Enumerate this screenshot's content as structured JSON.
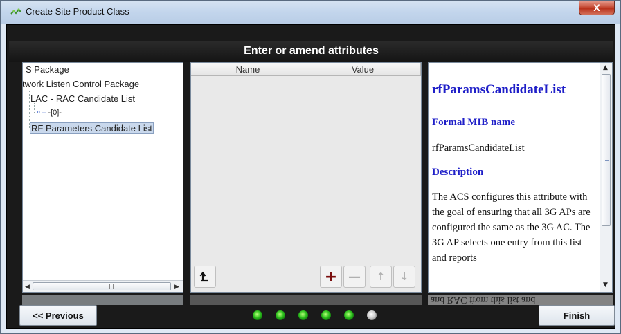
{
  "window": {
    "title": "Create Site Product Class",
    "close_label": "X"
  },
  "header": {
    "title": "Enter or amend attributes"
  },
  "tree": {
    "items": [
      {
        "label": "S Package"
      },
      {
        "label": "twork Listen Control Package"
      },
      {
        "label": "LAC - RAC Candidate List"
      },
      {
        "label": "-[0]-"
      },
      {
        "label": "RF Parameters Candidate List",
        "selected": true
      }
    ]
  },
  "table": {
    "columns": [
      "Name",
      "Value"
    ],
    "rows": []
  },
  "description": {
    "title": "rfParamsCandidateList",
    "formal_heading": "Formal MIB name",
    "formal_value": "rfParamsCandidateList",
    "desc_heading": "Description",
    "body": "The ACS configures this attribute with the goal of ensuring that all 3G APs are configured the same as the 3G AC. The 3G AP selects one entry from this list and reports"
  },
  "reflection": {
    "text": "and RAC from this list and"
  },
  "nav": {
    "previous_label": "<< Previous",
    "finish_label": "Finish",
    "steps": [
      "complete",
      "complete",
      "complete",
      "complete",
      "complete",
      "current"
    ]
  },
  "colors": {
    "header_bg": "#1a1a1a",
    "description_link": "#1f1fc8",
    "selected_bg": "#c9d8ec"
  }
}
